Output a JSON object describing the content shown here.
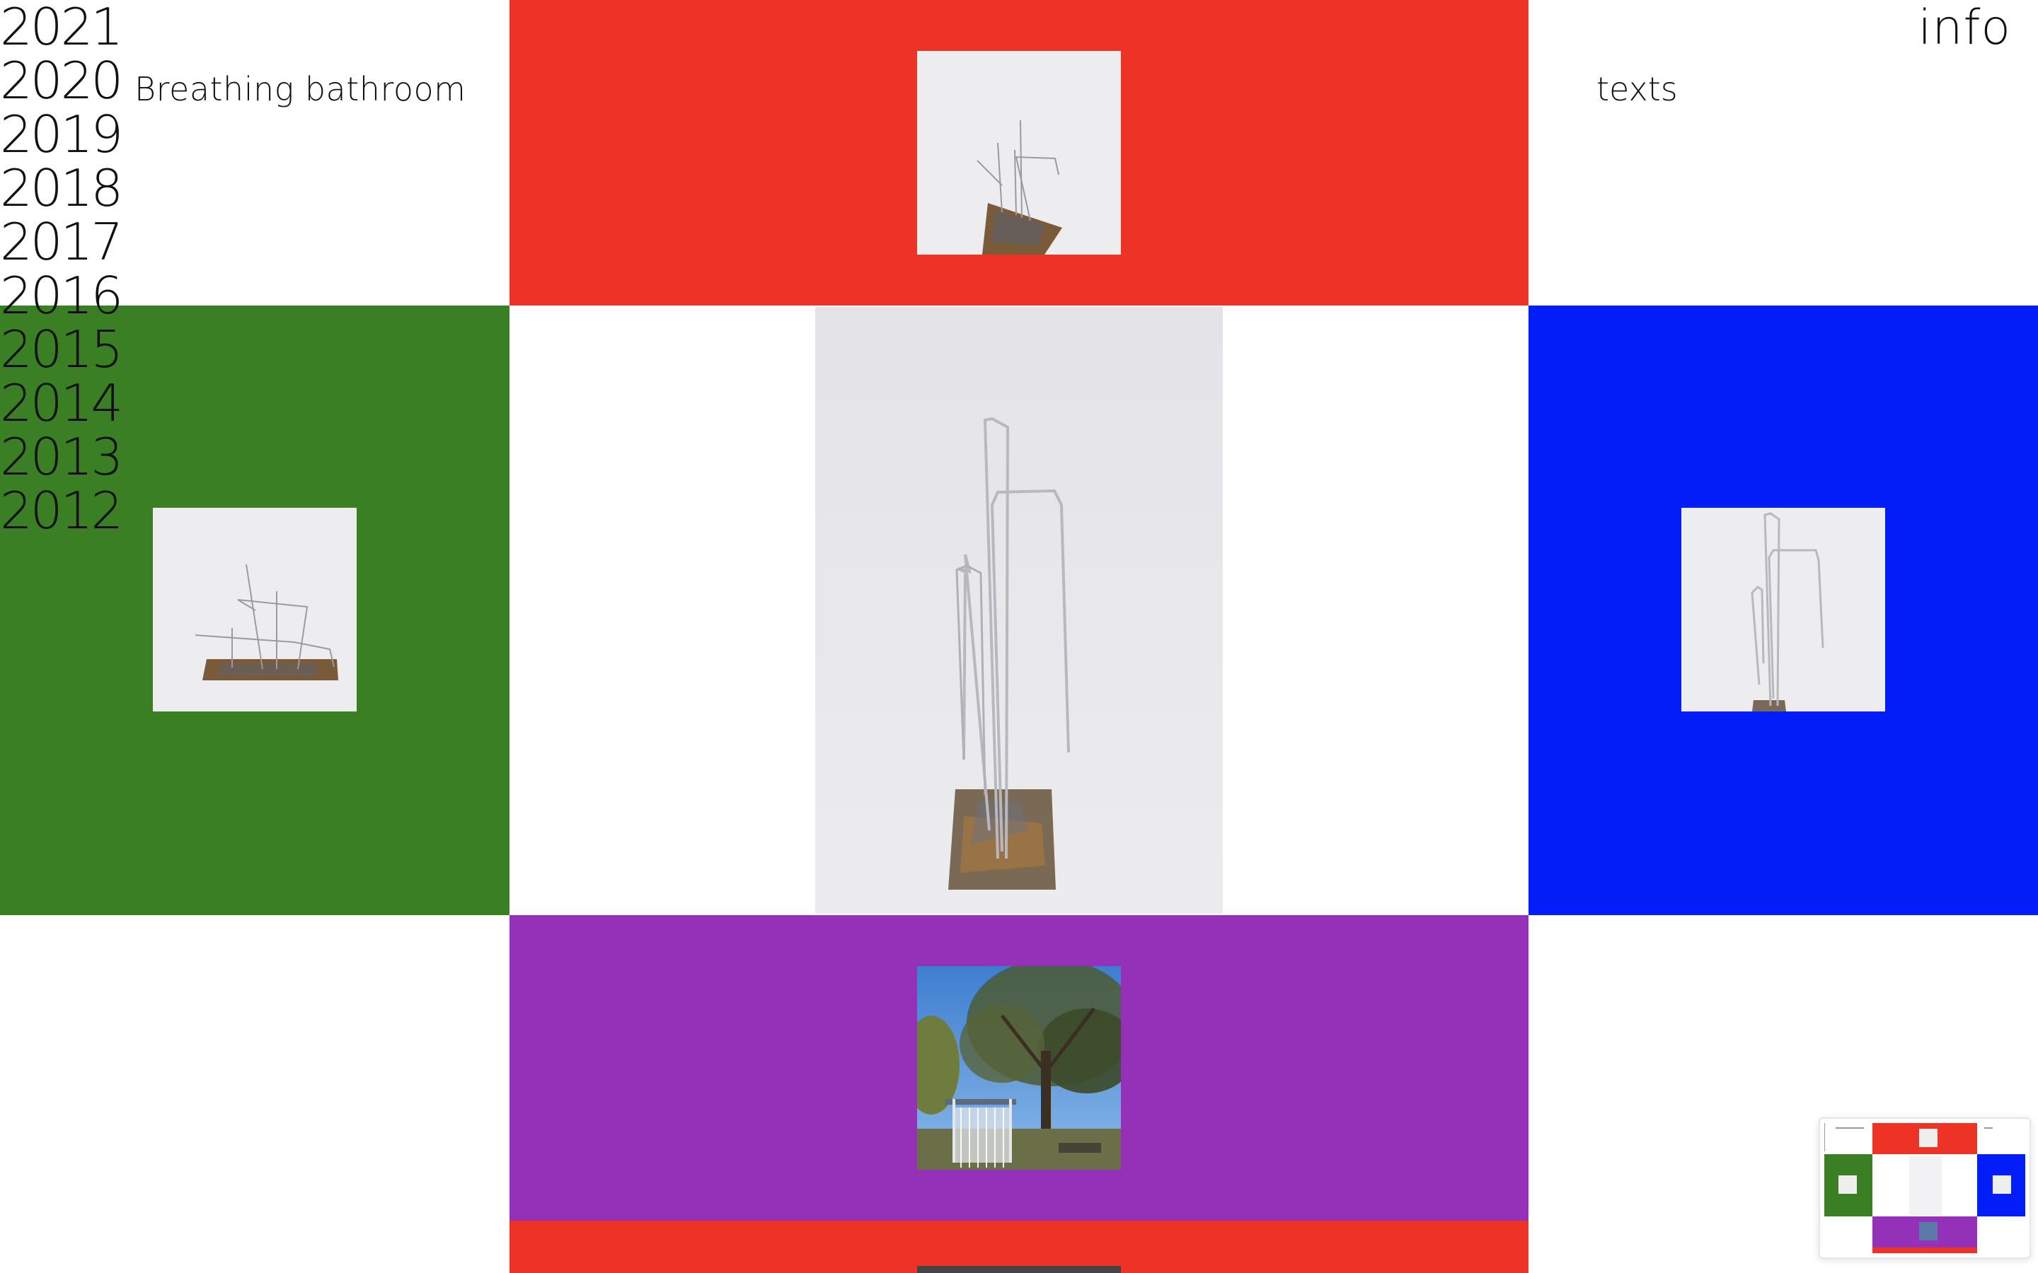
{
  "nav": {
    "years": [
      "2021",
      "2020",
      "2019",
      "2018",
      "2017",
      "2016",
      "2015",
      "2014",
      "2013",
      "2012"
    ]
  },
  "project": {
    "title": "Breathing bathroom"
  },
  "links": {
    "texts": "texts",
    "info": "info"
  },
  "colors": {
    "red": "#ec3325",
    "green": "#3a7f24",
    "blue": "#031df9",
    "purple": "#9531b8",
    "white": "#ffffff"
  },
  "images": [
    {
      "name": "sculpture-top-view",
      "tile": "red"
    },
    {
      "name": "sculpture-side-view",
      "tile": "green"
    },
    {
      "name": "sculpture-main-view",
      "tile": "white"
    },
    {
      "name": "sculpture-front-view",
      "tile": "blue"
    },
    {
      "name": "outdoor-installation-tree",
      "tile": "purple"
    },
    {
      "name": "next-project-image",
      "tile": "red"
    }
  ],
  "minimap": {
    "label": "page-overview"
  }
}
